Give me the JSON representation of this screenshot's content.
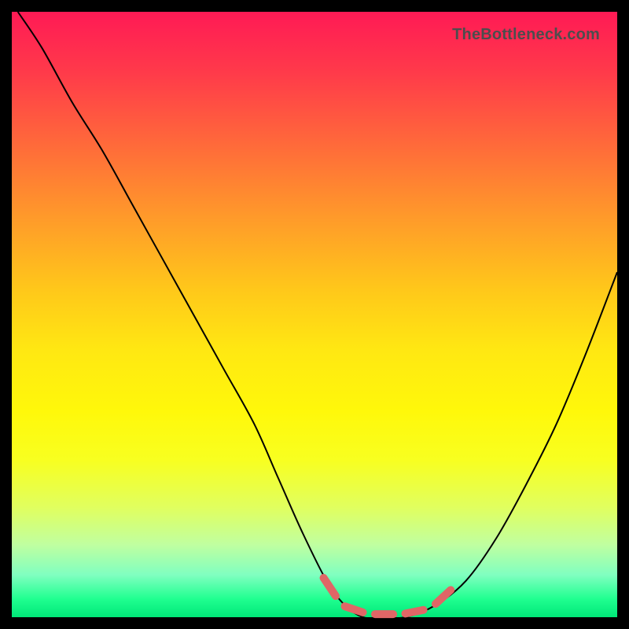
{
  "watermark": "TheBottleneck.com",
  "chart_data": {
    "type": "line",
    "title": "",
    "xlabel": "",
    "ylabel": "",
    "xlim": [
      0,
      100
    ],
    "ylim": [
      0,
      100
    ],
    "series": [
      {
        "name": "bottleneck-curve",
        "x": [
          1,
          5,
          10,
          15,
          20,
          25,
          30,
          35,
          40,
          44,
          48,
          52,
          55,
          58,
          61,
          65,
          70,
          75,
          80,
          85,
          90,
          95,
          100
        ],
        "y": [
          100,
          94,
          85,
          77,
          68,
          59,
          50,
          41,
          32,
          23,
          14,
          6,
          2,
          0,
          0,
          0,
          2,
          6,
          13,
          22,
          32,
          44,
          57
        ]
      }
    ],
    "markers": {
      "name": "highlight-dashes",
      "segments": [
        {
          "x1": 51.5,
          "y1": 6.5,
          "x2": 53.5,
          "y2": 3.5
        },
        {
          "x1": 55.0,
          "y1": 1.8,
          "x2": 58.0,
          "y2": 0.8
        },
        {
          "x1": 60.0,
          "y1": 0.5,
          "x2": 63.0,
          "y2": 0.5
        },
        {
          "x1": 65.0,
          "y1": 0.6,
          "x2": 68.0,
          "y2": 1.2
        },
        {
          "x1": 70.0,
          "y1": 2.2,
          "x2": 72.5,
          "y2": 4.5
        }
      ]
    }
  }
}
